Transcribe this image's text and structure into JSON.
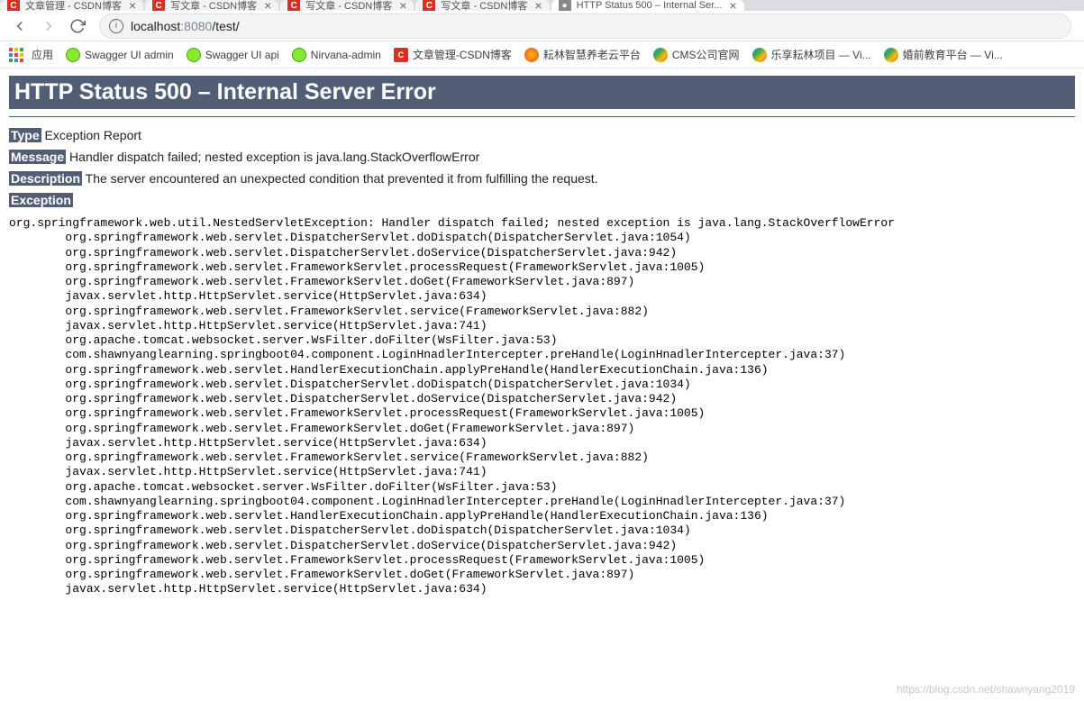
{
  "tabs": [
    {
      "fav": "C",
      "title": "文章管理 - CSDN博客"
    },
    {
      "fav": "C",
      "title": "写文章 - CSDN博客"
    },
    {
      "fav": "C",
      "title": "写文章 - CSDN博客"
    },
    {
      "fav": "C",
      "title": "写文章 - CSDN博客"
    },
    {
      "fav": "●",
      "title": "HTTP Status 500 – Internal Ser...",
      "active": true
    }
  ],
  "url": {
    "host": "localhost",
    "port": ":8080",
    "path": "/test/"
  },
  "bookmarks": {
    "apps": "应用",
    "items": [
      {
        "icon": "swagger",
        "label": "Swagger UI admin"
      },
      {
        "icon": "swagger",
        "label": "Swagger UI api"
      },
      {
        "icon": "swagger",
        "label": "Nirvana-admin"
      },
      {
        "icon": "csdn",
        "label": "文章管理-CSDN博客"
      },
      {
        "icon": "multi",
        "label": "耘林智慧养老云平台"
      },
      {
        "icon": "globe",
        "label": "CMS公司官网"
      },
      {
        "icon": "globe",
        "label": "乐享耘林项目 — Vi..."
      },
      {
        "icon": "globe",
        "label": "婚前教育平台 — Vi..."
      }
    ]
  },
  "error": {
    "title": "HTTP Status 500 – Internal Server Error",
    "type_label": "Type",
    "type_value": "Exception Report",
    "message_label": "Message",
    "message_value": "Handler dispatch failed; nested exception is java.lang.StackOverflowError",
    "description_label": "Description",
    "description_value": "The server encountered an unexpected condition that prevented it from fulfilling the request.",
    "exception_label": "Exception"
  },
  "stacktrace": "org.springframework.web.util.NestedServletException: Handler dispatch failed; nested exception is java.lang.StackOverflowError\n\torg.springframework.web.servlet.DispatcherServlet.doDispatch(DispatcherServlet.java:1054)\n\torg.springframework.web.servlet.DispatcherServlet.doService(DispatcherServlet.java:942)\n\torg.springframework.web.servlet.FrameworkServlet.processRequest(FrameworkServlet.java:1005)\n\torg.springframework.web.servlet.FrameworkServlet.doGet(FrameworkServlet.java:897)\n\tjavax.servlet.http.HttpServlet.service(HttpServlet.java:634)\n\torg.springframework.web.servlet.FrameworkServlet.service(FrameworkServlet.java:882)\n\tjavax.servlet.http.HttpServlet.service(HttpServlet.java:741)\n\torg.apache.tomcat.websocket.server.WsFilter.doFilter(WsFilter.java:53)\n\tcom.shawnyanglearning.springboot04.component.LoginHnadlerIntercepter.preHandle(LoginHnadlerIntercepter.java:37)\n\torg.springframework.web.servlet.HandlerExecutionChain.applyPreHandle(HandlerExecutionChain.java:136)\n\torg.springframework.web.servlet.DispatcherServlet.doDispatch(DispatcherServlet.java:1034)\n\torg.springframework.web.servlet.DispatcherServlet.doService(DispatcherServlet.java:942)\n\torg.springframework.web.servlet.FrameworkServlet.processRequest(FrameworkServlet.java:1005)\n\torg.springframework.web.servlet.FrameworkServlet.doGet(FrameworkServlet.java:897)\n\tjavax.servlet.http.HttpServlet.service(HttpServlet.java:634)\n\torg.springframework.web.servlet.FrameworkServlet.service(FrameworkServlet.java:882)\n\tjavax.servlet.http.HttpServlet.service(HttpServlet.java:741)\n\torg.apache.tomcat.websocket.server.WsFilter.doFilter(WsFilter.java:53)\n\tcom.shawnyanglearning.springboot04.component.LoginHnadlerIntercepter.preHandle(LoginHnadlerIntercepter.java:37)\n\torg.springframework.web.servlet.HandlerExecutionChain.applyPreHandle(HandlerExecutionChain.java:136)\n\torg.springframework.web.servlet.DispatcherServlet.doDispatch(DispatcherServlet.java:1034)\n\torg.springframework.web.servlet.DispatcherServlet.doService(DispatcherServlet.java:942)\n\torg.springframework.web.servlet.FrameworkServlet.processRequest(FrameworkServlet.java:1005)\n\torg.springframework.web.servlet.FrameworkServlet.doGet(FrameworkServlet.java:897)\n\tjavax.servlet.http.HttpServlet.service(HttpServlet.java:634)",
  "watermark": "https://blog.csdn.net/shawnyang2019"
}
